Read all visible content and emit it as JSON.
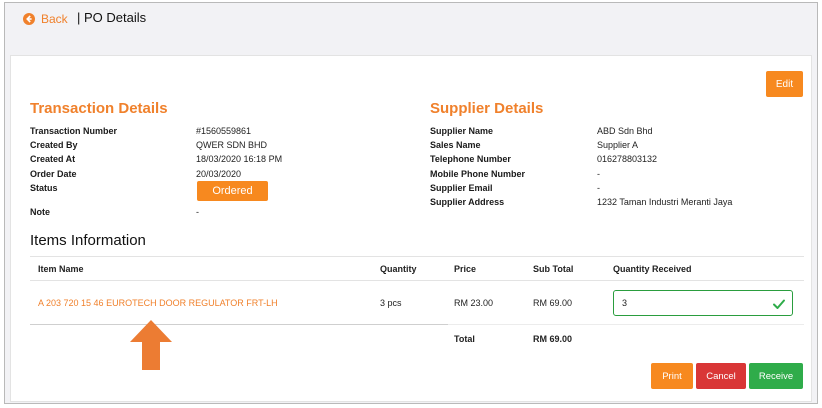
{
  "header": {
    "back_label": "Back",
    "title": "| PO Details"
  },
  "actions": {
    "edit_label": "Edit",
    "print_label": "Print",
    "cancel_label": "Cancel",
    "receive_label": "Receive"
  },
  "transaction": {
    "title": "Transaction Details",
    "fields": [
      {
        "label": "Transaction Number",
        "value": "#1560559861"
      },
      {
        "label": "Created By",
        "value": "QWER SDN BHD"
      },
      {
        "label": "Created At",
        "value": "18/03/2020 16:18 PM"
      },
      {
        "label": "Order Date",
        "value": "20/03/2020"
      },
      {
        "label": "Status",
        "value": "Ordered"
      },
      {
        "label": "Note",
        "value": "-"
      }
    ]
  },
  "supplier": {
    "title": "Supplier Details",
    "fields": [
      {
        "label": "Supplier Name",
        "value": "ABD Sdn Bhd"
      },
      {
        "label": "Sales Name",
        "value": "Supplier A"
      },
      {
        "label": "Telephone Number",
        "value": "016278803132"
      },
      {
        "label": "Mobile Phone Number",
        "value": "-"
      },
      {
        "label": "Supplier Email",
        "value": "-"
      },
      {
        "label": "Supplier Address",
        "value": "1232 Taman Industri Meranti Jaya"
      }
    ]
  },
  "items": {
    "title": "Items Information",
    "columns": [
      "Item Name",
      "Quantity",
      "Price",
      "Sub Total",
      "Quantity Received"
    ],
    "rows": [
      {
        "name": "A 203 720 15 46 EUROTECH DOOR REGULATOR FRT-LH",
        "quantity": "3 pcs",
        "price": "RM 23.00",
        "subtotal": "RM 69.00",
        "received": "3"
      }
    ],
    "total_label": "Total",
    "total_value": "RM 69.00"
  },
  "colors": {
    "accent": "#f0812c",
    "cancel": "#d93636",
    "receive": "#2fac4a",
    "valid_border": "#2a9d3e"
  }
}
